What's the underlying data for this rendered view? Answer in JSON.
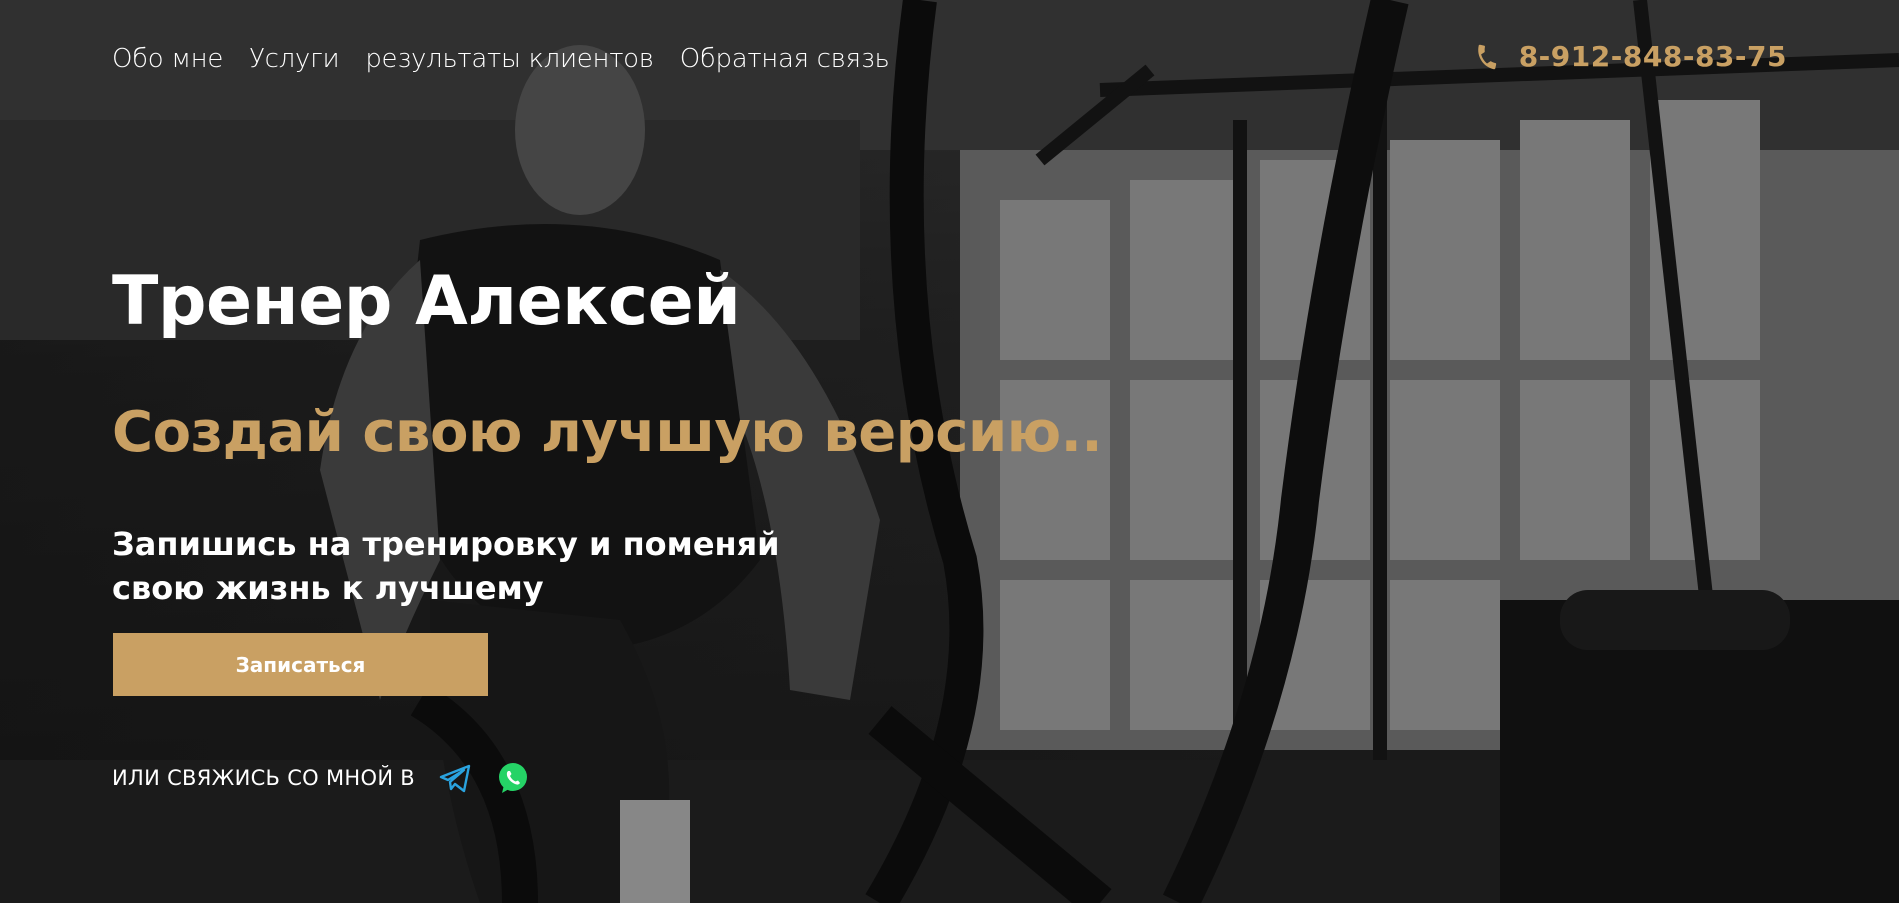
{
  "nav": {
    "items": [
      {
        "label": "Обо мне"
      },
      {
        "label": "Услуги"
      },
      {
        "label": "результаты клиентов"
      },
      {
        "label": "Обратная связь"
      }
    ]
  },
  "header": {
    "phone": "8-912-848-83-75",
    "phone_icon": "phone-icon"
  },
  "hero": {
    "title": "Тренер Алексей",
    "slogan": "Создай свою лучшую версию..",
    "subtitle_line1": "Запишись на тренировку и поменяй",
    "subtitle_line2": "свою жизнь к лучшему",
    "cta_label": "Записаться",
    "contact_text": "ИЛИ СВЯЖИСЬ СО МНОЙ В",
    "socials": [
      {
        "name": "telegram-icon"
      },
      {
        "name": "whatsapp-icon"
      }
    ]
  },
  "colors": {
    "accent": "#c9a063",
    "text": "#ffffff",
    "telegram": "#2aa3df",
    "whatsapp": "#25d366"
  }
}
